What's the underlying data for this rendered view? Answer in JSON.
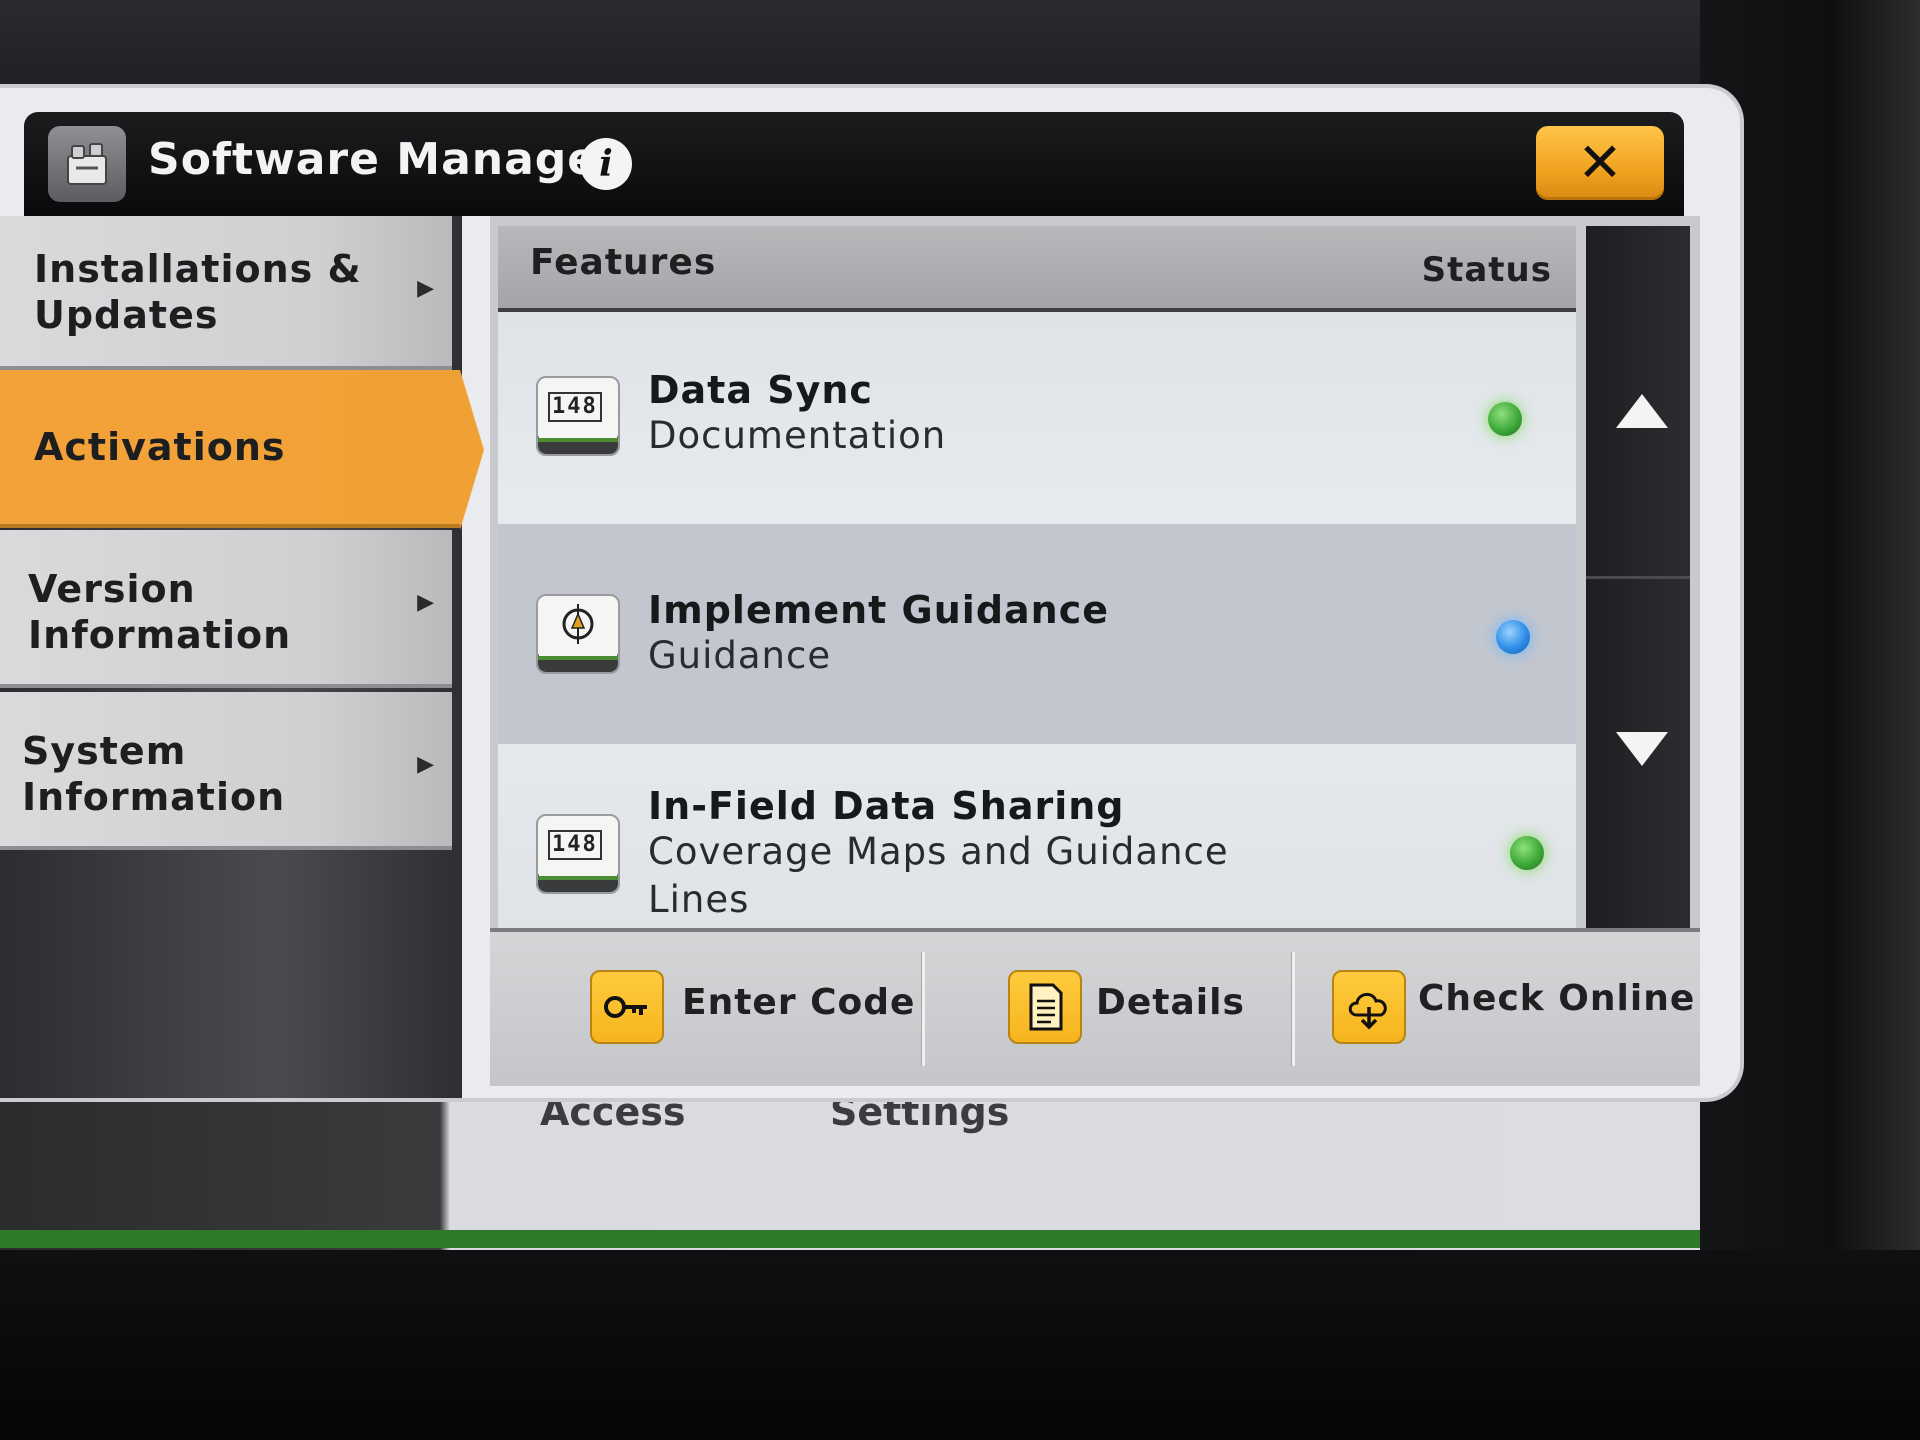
{
  "dialog": {
    "title": "Software Manager",
    "info_icon": "info-icon",
    "close_label": "✕"
  },
  "sidebar": {
    "items": [
      {
        "label": "Installations & Updates",
        "active": false
      },
      {
        "label": "Activations",
        "active": true
      },
      {
        "label": "Version Information",
        "active": false
      },
      {
        "label": "System Information",
        "active": false
      }
    ]
  },
  "features": {
    "header": {
      "features": "Features",
      "status": "Status"
    },
    "rows": [
      {
        "name": "Data Sync",
        "category": "Documentation",
        "icon": "counter-icon",
        "status_color": "#3fa93a"
      },
      {
        "name": "Implement Guidance",
        "category": "Guidance",
        "icon": "implement-guidance-icon",
        "status_color": "#2f8ee8"
      },
      {
        "name": "In-Field Data Sharing",
        "category": "Coverage Maps and Guidance Lines",
        "icon": "counter-icon",
        "status_color": "#3fa93a"
      }
    ],
    "icon_digits": "148"
  },
  "actions": {
    "enter_code": "Enter Code",
    "details": "Details",
    "check_online": "Check Online"
  },
  "background": {
    "label_1": "Access",
    "label_2": "Settings"
  },
  "colors": {
    "accent": "#f0a135",
    "status_active": "#3fa93a",
    "status_info": "#2f8ee8",
    "button_yellow": "#f6b51e"
  }
}
